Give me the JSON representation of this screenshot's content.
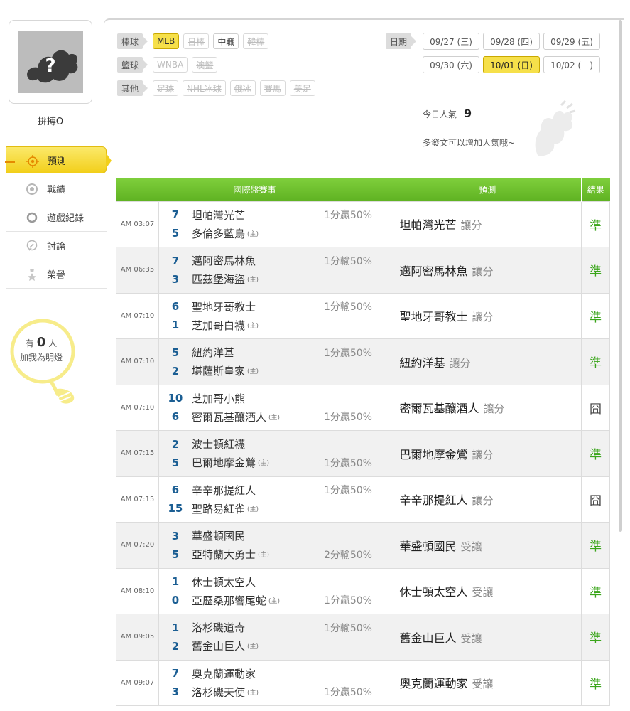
{
  "user": {
    "name": "拚搏O"
  },
  "nav": [
    {
      "label": "預測",
      "icon": "target-icon",
      "active": true
    },
    {
      "label": "戰績",
      "icon": "record-icon",
      "active": false
    },
    {
      "label": "遊戲紀錄",
      "icon": "ring-icon",
      "active": false
    },
    {
      "label": "討論",
      "icon": "discussion-icon",
      "active": false
    },
    {
      "label": "榮譽",
      "icon": "medal-icon",
      "active": false
    }
  ],
  "lamp": {
    "prefix": "有",
    "count": "0",
    "suffix": "人",
    "line2": "加我為明燈"
  },
  "filters": [
    {
      "category": "棒球",
      "items": [
        {
          "label": "MLB",
          "state": "selected"
        },
        {
          "label": "日棒",
          "state": "disabled"
        },
        {
          "label": "中職",
          "state": "normal"
        },
        {
          "label": "韓棒",
          "state": "disabled"
        }
      ]
    },
    {
      "category": "籃球",
      "items": [
        {
          "label": "WNBA",
          "state": "disabled"
        },
        {
          "label": "澳籃",
          "state": "disabled"
        }
      ]
    },
    {
      "category": "其他",
      "items": [
        {
          "label": "足球",
          "state": "disabled"
        },
        {
          "label": "NHL冰球",
          "state": "disabled"
        },
        {
          "label": "俄冰",
          "state": "disabled"
        },
        {
          "label": "賽馬",
          "state": "disabled"
        },
        {
          "label": "美足",
          "state": "disabled"
        }
      ]
    }
  ],
  "date_label": "日期",
  "dates": [
    {
      "label": "09/27 (三)",
      "selected": false
    },
    {
      "label": "09/28 (四)",
      "selected": false
    },
    {
      "label": "09/29 (五)",
      "selected": false
    },
    {
      "label": "09/30 (六)",
      "selected": false
    },
    {
      "label": "10/01 (日)",
      "selected": true
    },
    {
      "label": "10/02 (一)",
      "selected": false
    }
  ],
  "popularity": {
    "label": "今日人氣",
    "value": "9",
    "hint": "多發文可以增加人氣哦~"
  },
  "table": {
    "headers": [
      "國際盤賽事",
      "預測",
      "結果"
    ],
    "home_mark": "(主)",
    "rows": [
      {
        "time": "AM 03:07",
        "away": {
          "score": "7",
          "team": "坦帕灣光芒"
        },
        "home": {
          "score": "5",
          "team": "多倫多藍鳥"
        },
        "handicap": "1分贏50%",
        "hc_line": "away",
        "pick": "坦帕灣光芒",
        "bet": "讓分",
        "result": "準"
      },
      {
        "time": "AM 06:35",
        "away": {
          "score": "7",
          "team": "邁阿密馬林魚"
        },
        "home": {
          "score": "3",
          "team": "匹茲堡海盜"
        },
        "handicap": "1分輸50%",
        "hc_line": "away",
        "pick": "邁阿密馬林魚",
        "bet": "讓分",
        "result": "準"
      },
      {
        "time": "AM 07:10",
        "away": {
          "score": "6",
          "team": "聖地牙哥教士"
        },
        "home": {
          "score": "1",
          "team": "芝加哥白襪"
        },
        "handicap": "1分輸50%",
        "hc_line": "away",
        "pick": "聖地牙哥教士",
        "bet": "讓分",
        "result": "準"
      },
      {
        "time": "AM 07:10",
        "away": {
          "score": "5",
          "team": "紐約洋基"
        },
        "home": {
          "score": "2",
          "team": "堪薩斯皇家"
        },
        "handicap": "1分贏50%",
        "hc_line": "away",
        "pick": "紐約洋基",
        "bet": "讓分",
        "result": "準"
      },
      {
        "time": "AM 07:10",
        "away": {
          "score": "10",
          "team": "芝加哥小熊"
        },
        "home": {
          "score": "6",
          "team": "密爾瓦基釀酒人"
        },
        "handicap": "1分贏50%",
        "hc_line": "home",
        "pick": "密爾瓦基釀酒人",
        "bet": "讓分",
        "result": "囧"
      },
      {
        "time": "AM 07:15",
        "away": {
          "score": "2",
          "team": "波士頓紅襪"
        },
        "home": {
          "score": "5",
          "team": "巴爾地摩金鶯"
        },
        "handicap": "1分贏50%",
        "hc_line": "home",
        "pick": "巴爾地摩金鶯",
        "bet": "讓分",
        "result": "準"
      },
      {
        "time": "AM 07:15",
        "away": {
          "score": "6",
          "team": "辛辛那提紅人"
        },
        "home": {
          "score": "15",
          "team": "聖路易紅雀"
        },
        "handicap": "1分贏50%",
        "hc_line": "away",
        "pick": "辛辛那提紅人",
        "bet": "讓分",
        "result": "囧"
      },
      {
        "time": "AM 07:20",
        "away": {
          "score": "3",
          "team": "華盛頓國民"
        },
        "home": {
          "score": "5",
          "team": "亞特蘭大勇士"
        },
        "handicap": "2分輸50%",
        "hc_line": "home",
        "pick": "華盛頓國民",
        "bet": "受讓",
        "result": "準"
      },
      {
        "time": "AM 08:10",
        "away": {
          "score": "1",
          "team": "休士頓太空人"
        },
        "home": {
          "score": "0",
          "team": "亞歷桑那響尾蛇"
        },
        "handicap": "1分贏50%",
        "hc_line": "home",
        "pick": "休士頓太空人",
        "bet": "受讓",
        "result": "準"
      },
      {
        "time": "AM 09:05",
        "away": {
          "score": "1",
          "team": "洛杉磯道奇"
        },
        "home": {
          "score": "2",
          "team": "舊金山巨人"
        },
        "handicap": "1分輸50%",
        "hc_line": "away",
        "pick": "舊金山巨人",
        "bet": "受讓",
        "result": "準"
      },
      {
        "time": "AM 09:07",
        "away": {
          "score": "7",
          "team": "奧克蘭運動家"
        },
        "home": {
          "score": "3",
          "team": "洛杉磯天使"
        },
        "handicap": "1分贏50%",
        "hc_line": "home",
        "pick": "奧克蘭運動家",
        "bet": "受讓",
        "result": "準"
      }
    ]
  },
  "colors": {
    "accent_yellow": "#f6e04a",
    "header_green": "#6cbd2c",
    "hit_green": "#3aa51a",
    "score_blue": "#1b5e93"
  }
}
